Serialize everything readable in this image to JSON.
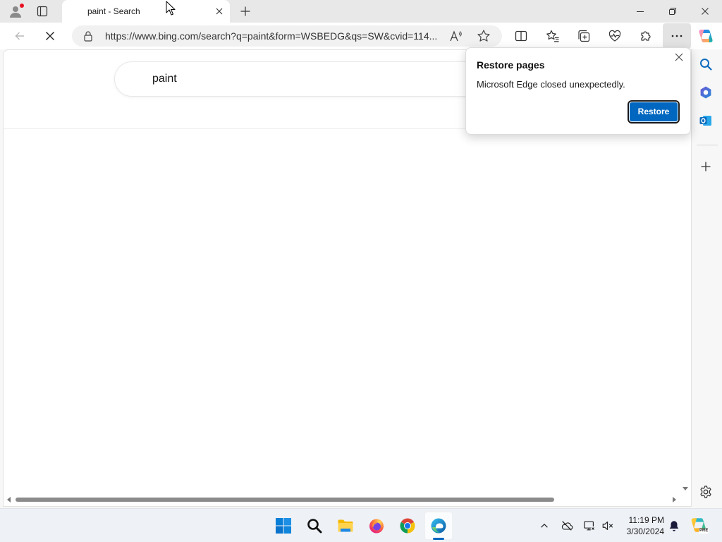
{
  "browser": {
    "tabs": [
      {
        "label": "paint - Search",
        "active": true
      }
    ],
    "address_bar": {
      "url": "https://www.bing.com/search?q=paint&form=WSBEDG&qs=SW&cvid=114..."
    },
    "toolbar_icons": [
      "back-icon",
      "stop-icon",
      "lock-icon",
      "read-aloud-icon",
      "favorite-star-icon",
      "split-screen-icon",
      "favorites-icon",
      "collections-icon",
      "browser-essentials-icon",
      "extensions-icon",
      "more-icon",
      "copilot-icon"
    ],
    "sidebar_icons": [
      "search-icon",
      "office-icon",
      "outlook-icon",
      "add-icon",
      "settings-icon"
    ]
  },
  "page": {
    "search_query": "paint"
  },
  "restore_popup": {
    "title": "Restore pages",
    "message": "Microsoft Edge closed unexpectedly.",
    "button_label": "Restore"
  },
  "taskbar": {
    "apps": [
      "start-icon",
      "search-icon",
      "file-explorer-icon",
      "firefox-icon",
      "chrome-icon",
      "edge-icon"
    ],
    "active_app": "edge-icon",
    "tray_icons": [
      "show-hidden-icons-icon",
      "onedrive-offline-icon",
      "network-icon",
      "volume-muted-icon",
      "notification-bell-icon",
      "copilot-icon"
    ],
    "time": "11:19 PM",
    "date": "3/30/2024",
    "copilot_badge": "PRE"
  },
  "colors": {
    "accent": "#0067c0",
    "profile_dot": "#e81123"
  }
}
